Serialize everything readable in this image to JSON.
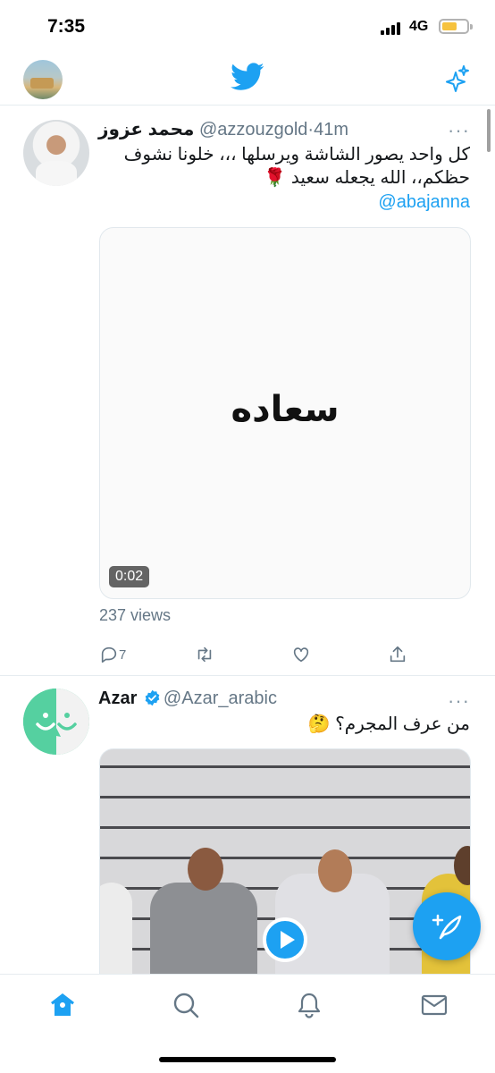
{
  "status_bar": {
    "time": "7:35",
    "network": "4G"
  },
  "tweets": [
    {
      "author_name": "محمد عزوز",
      "handle": "@azzouzgold",
      "separator": "·",
      "time": "41m",
      "more": "···",
      "text": "كل واحد يصور  الشاشة ويرسلها ،،، خلونا نشوف حظكم،، الله يجعله سعيد 🌹",
      "mention": "@abajanna",
      "video": {
        "caption": "سعاده",
        "duration": "0:02"
      },
      "views": "237 views",
      "reply_count": "7"
    },
    {
      "author_name": "Azar",
      "handle": "@Azar_arabic",
      "more": "···",
      "text": "من عرف المجرم؟ 🤔"
    }
  ],
  "colors": {
    "accent": "#1da1f2",
    "secondary_text": "#657786",
    "divider": "#e6ecf0",
    "azar_green": "#55d0a0"
  },
  "icons": [
    "twitter-logo-icon",
    "sparkle-icon",
    "reply-icon",
    "retweet-icon",
    "like-icon",
    "share-icon",
    "verified-icon",
    "play-icon",
    "compose-icon",
    "home-icon",
    "search-icon",
    "bell-icon",
    "mail-icon"
  ]
}
